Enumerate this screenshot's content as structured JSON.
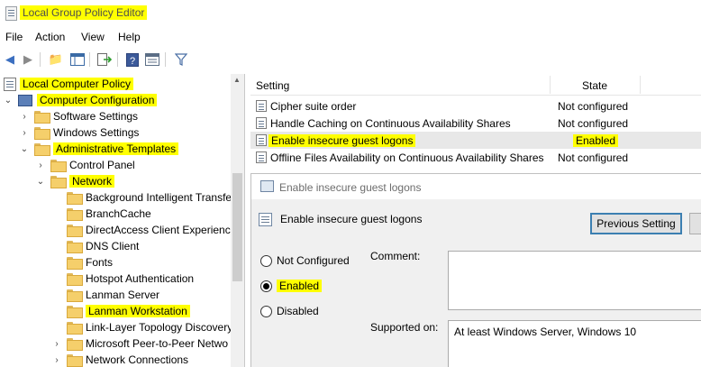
{
  "window": {
    "title": "Local Group Policy Editor"
  },
  "menu": [
    "File",
    "Action",
    "View",
    "Help"
  ],
  "toolbar": {
    "icons": [
      "back-arrow-icon",
      "forward-arrow-icon",
      "up-folder-icon",
      "show-hide-tree-icon",
      "export-list-icon",
      "help-icon",
      "properties-icon",
      "filter-icon"
    ]
  },
  "tree": {
    "items": [
      {
        "label": "Local Computer Policy",
        "highlighted": true
      },
      {
        "label": "Computer Configuration",
        "highlighted": true
      },
      {
        "label": "Software Settings"
      },
      {
        "label": "Windows Settings"
      },
      {
        "label": "Administrative Templates",
        "highlighted": true
      },
      {
        "label": "Control Panel"
      },
      {
        "label": "Network",
        "highlighted": true
      },
      {
        "label": "Background Intelligent Transfe"
      },
      {
        "label": "BranchCache"
      },
      {
        "label": "DirectAccess Client Experience"
      },
      {
        "label": "DNS Client"
      },
      {
        "label": "Fonts"
      },
      {
        "label": "Hotspot Authentication"
      },
      {
        "label": "Lanman Server"
      },
      {
        "label": "Lanman Workstation",
        "highlighted": true,
        "selected": true
      },
      {
        "label": "Link-Layer Topology Discovery"
      },
      {
        "label": "Microsoft Peer-to-Peer Netwo"
      },
      {
        "label": "Network Connections"
      }
    ]
  },
  "settings": {
    "header": {
      "setting": "Setting",
      "state": "State"
    },
    "rows": [
      {
        "name": "Cipher suite order",
        "state": "Not configured"
      },
      {
        "name": "Handle Caching on Continuous Availability Shares",
        "state": "Not configured"
      },
      {
        "name": "Enable insecure guest logons",
        "state": "Enabled",
        "highlighted": true,
        "selected": true
      },
      {
        "name": "Offline Files Availability on Continuous Availability Shares",
        "state": "Not configured"
      }
    ]
  },
  "dialog": {
    "title": "Enable insecure guest logons",
    "heading": "Enable insecure guest logons",
    "previous_button": "Previous Setting",
    "options": [
      {
        "label": "Not Configured",
        "checked": false
      },
      {
        "label": "Enabled",
        "checked": true,
        "highlighted": true
      },
      {
        "label": "Disabled",
        "checked": false
      }
    ],
    "comment_label": "Comment:",
    "supported_label": "Supported on:",
    "supported_value": "At least Windows Server, Windows 10"
  },
  "colors": {
    "highlight": "#ffff00",
    "selection": "#cce8ff"
  }
}
